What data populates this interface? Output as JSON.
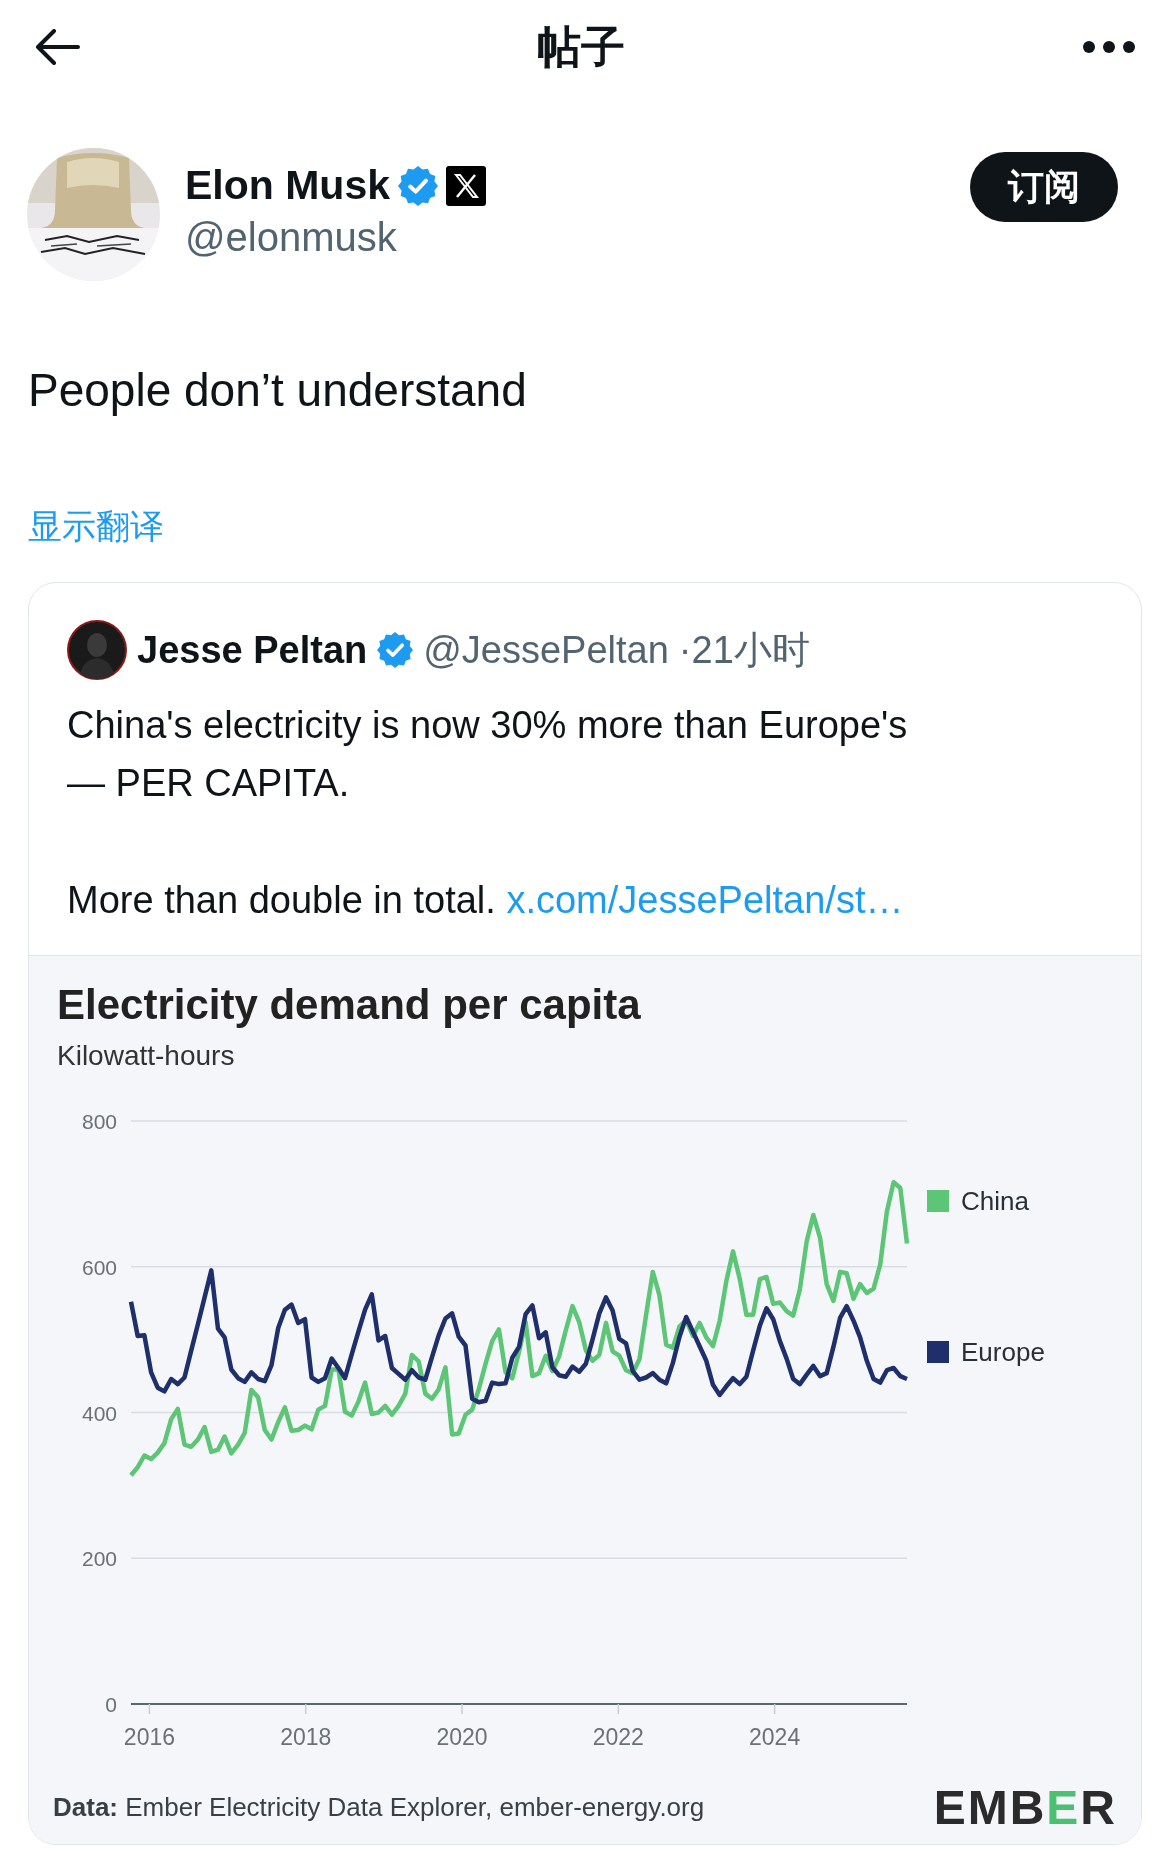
{
  "header": {
    "title": "帖子"
  },
  "post": {
    "author": {
      "name": "Elon Musk",
      "handle": "@elonmusk",
      "verified": true
    },
    "subscribe_button": "订阅",
    "text": "People don’t understand",
    "translate_link": "显示翻译",
    "quoted_post": {
      "author": {
        "name": "Jesse Peltan",
        "handle": "@JessePeltan",
        "verified": true
      },
      "time": "·21小时",
      "paragraphs": [
        "China's electricity is now 30% more than Europe's\n— PER CAPITA.",
        "More than double in total."
      ],
      "link": "x.com/JessePeltan/st…",
      "chart": {
        "chart_data": {
          "type": "line",
          "title": "Electricity demand per capita",
          "ylabel": "Kilowatt-hours",
          "x": [
            2015.764,
            2015.85,
            2015.935,
            2016.021,
            2016.106,
            2016.192,
            2016.278,
            2016.363,
            2016.449,
            2016.534,
            2016.62,
            2016.706,
            2016.791,
            2016.877,
            2016.962,
            2017.048,
            2017.134,
            2017.219,
            2017.305,
            2017.39,
            2017.476,
            2017.562,
            2017.647,
            2017.733,
            2017.818,
            2017.904,
            2017.99,
            2018.075,
            2018.161,
            2018.246,
            2018.332,
            2018.418,
            2018.503,
            2018.589,
            2018.674,
            2018.76,
            2018.846,
            2018.931,
            2019.017,
            2019.102,
            2019.188,
            2019.274,
            2019.359,
            2019.445,
            2019.53,
            2019.616,
            2019.702,
            2019.787,
            2019.873,
            2019.958,
            2020.044,
            2020.13,
            2020.215,
            2020.301,
            2020.386,
            2020.472,
            2020.558,
            2020.643,
            2020.729,
            2020.814,
            2020.9,
            2020.986,
            2021.071,
            2021.157,
            2021.242,
            2021.328,
            2021.414,
            2021.499,
            2021.585,
            2021.67,
            2021.756,
            2021.842,
            2021.927,
            2022.013,
            2022.098,
            2022.184,
            2022.27,
            2022.355,
            2022.441,
            2022.526,
            2022.612,
            2022.698,
            2022.783,
            2022.869,
            2022.954,
            2023.04,
            2023.126,
            2023.211,
            2023.297,
            2023.382,
            2023.468,
            2023.554,
            2023.639,
            2023.725,
            2023.81,
            2023.896,
            2023.982,
            2024.067,
            2024.153,
            2024.238,
            2024.324,
            2024.41,
            2024.495,
            2024.581,
            2024.666,
            2024.752,
            2024.838,
            2024.923,
            2025.009,
            2025.094,
            2025.18,
            2025.266,
            2025.351,
            2025.437,
            2025.522,
            2025.608,
            2025.694
          ],
          "series": [
            {
              "name": "China",
              "color": "#5cc576",
              "values": [
                314,
                325,
                341,
                336,
                345,
                358,
                391,
                405,
                356,
                353,
                363,
                380,
                346,
                349,
                367,
                344,
                356,
                372,
                431,
                421,
                376,
                363,
                387,
                407,
                375,
                376,
                382,
                377,
                404,
                409,
                459,
                459,
                401,
                396,
                415,
                441,
                398,
                400,
                409,
                397,
                409,
                426,
                479,
                470,
                426,
                419,
                432,
                462,
                370,
                371,
                397,
                404,
                432,
                467,
                498,
                514,
                455,
                447,
                483,
                524,
                450,
                454,
                478,
                457,
                477,
                513,
                546,
                524,
                485,
                471,
                479,
                523,
                484,
                478,
                458,
                454,
                473,
                534,
                593,
                561,
                493,
                489,
                518,
                527,
                505,
                523,
                503,
                491,
                526,
                580,
                621,
                583,
                534,
                534,
                583,
                586,
                549,
                551,
                539,
                533,
                569,
                635,
                671,
                640,
                576,
                553,
                593,
                591,
                556,
                576,
                564,
                570,
                603,
                676,
                716,
                708,
                632
              ]
            },
            {
              "name": "Europe",
              "color": "#1e2f6b",
              "values": [
                552,
                505,
                506,
                455,
                434,
                429,
                446,
                439,
                448,
                485,
                521,
                558,
                595,
                515,
                503,
                459,
                447,
                442,
                455,
                446,
                443,
                465,
                516,
                541,
                548,
                523,
                528,
                448,
                442,
                447,
                474,
                461,
                447,
                480,
                511,
                541,
                562,
                499,
                505,
                461,
                453,
                445,
                458,
                448,
                445,
                476,
                506,
                529,
                536,
                504,
                492,
                419,
                414,
                416,
                441,
                439,
                440,
                475,
                490,
                535,
                547,
                502,
                510,
                462,
                451,
                449,
                463,
                456,
                467,
                500,
                536,
                558,
                540,
                501,
                495,
                457,
                445,
                448,
                454,
                445,
                440,
                468,
                504,
                531,
                511,
                491,
                471,
                438,
                424,
                436,
                447,
                439,
                449,
                485,
                519,
                543,
                528,
                498,
                474,
                446,
                439,
                452,
                464,
                450,
                454,
                490,
                530,
                546,
                526,
                503,
                471,
                446,
                441,
                458,
                461,
                450,
                446
              ]
            }
          ],
          "xlim": [
            2015.764,
            2025.694
          ],
          "ylim": [
            0,
            800
          ],
          "xticks": [
            2016,
            2018,
            2020,
            2022,
            2024
          ],
          "yticks": [
            0,
            200,
            400,
            600,
            800
          ],
          "grid": true,
          "legend": true
        },
        "source": "**Data:** Ember Electricity Data Explorer, ember-energy.org",
        "logo": [
          {
            "text": "EMB",
            "accent": false
          },
          {
            "text": "E",
            "accent": true
          },
          {
            "text": "R",
            "accent": false
          }
        ]
      }
    }
  }
}
